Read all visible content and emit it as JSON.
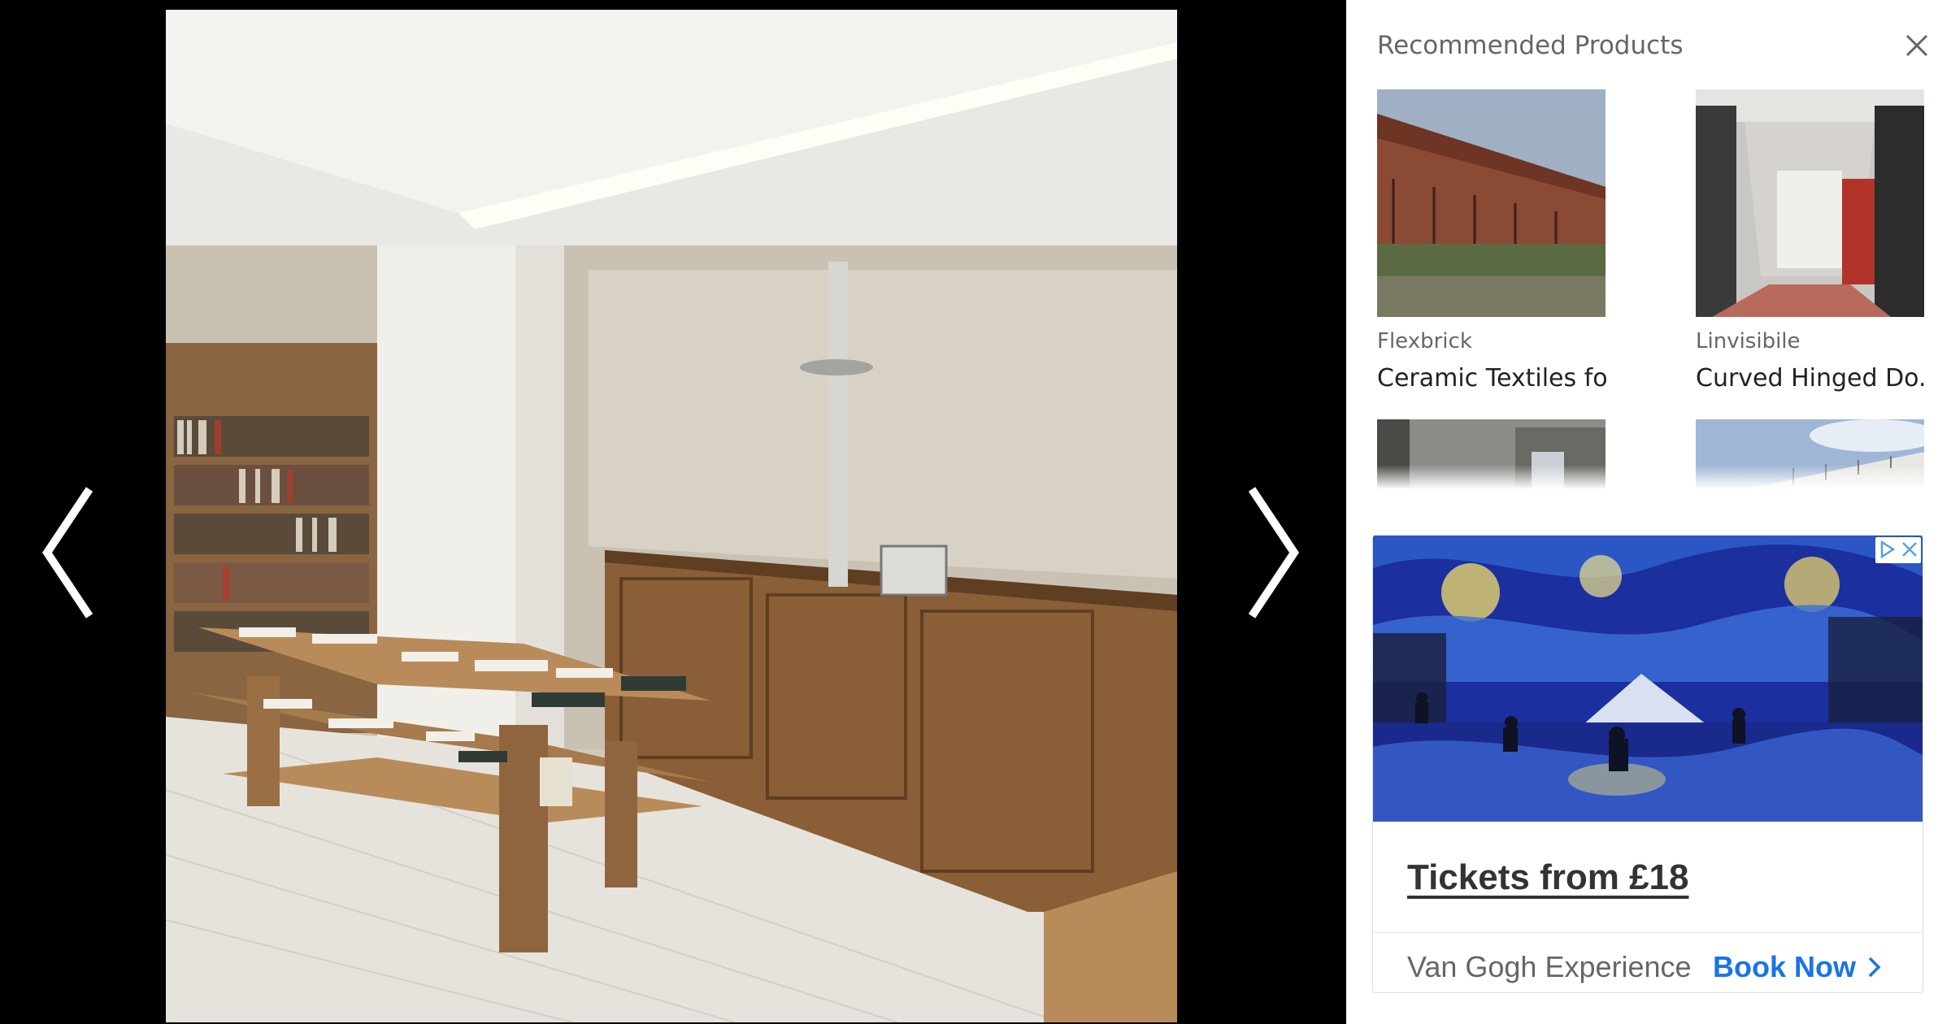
{
  "gallery": {
    "prev_label": "Previous image",
    "next_label": "Next image",
    "photo_icon": "bookshop-interior-photo"
  },
  "sidebar": {
    "title": "Recommended Products",
    "close_icon": "close-icon",
    "products": [
      {
        "brand": "Flexbrick",
        "name": "Ceramic Textiles fo..."
      },
      {
        "brand": "Linvisibile",
        "name": "Curved Hinged Do..."
      }
    ]
  },
  "ad": {
    "headline": "Tickets from £18",
    "advertiser": "Van Gogh Experience",
    "cta": "Book Now",
    "colors": {
      "cta": "#1a73e8",
      "headline": "#333333"
    }
  }
}
